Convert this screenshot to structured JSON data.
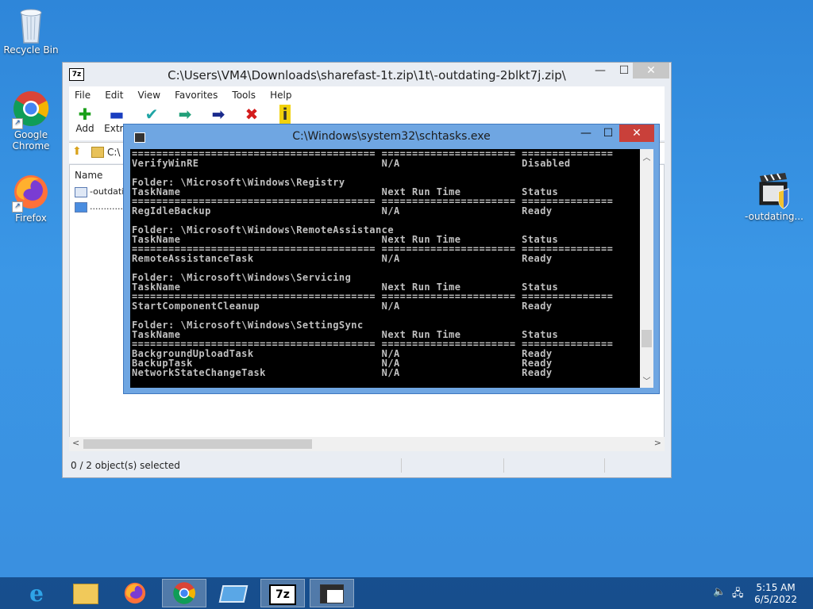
{
  "desktop": {
    "icons": [
      {
        "label": "Recycle Bin"
      },
      {
        "label": "Google Chrome"
      },
      {
        "label": "Firefox"
      },
      {
        "label": "-outdating..."
      }
    ]
  },
  "sevenzip": {
    "title": "C:\\Users\\VM4\\Downloads\\sharefast-1t.zip\\1t\\-outdating-2blkt7j.zip\\",
    "app_icon": "7z",
    "menu": [
      "File",
      "Edit",
      "View",
      "Favorites",
      "Tools",
      "Help"
    ],
    "toolbar": {
      "add_label": "Add",
      "extract_label": "Extra"
    },
    "address_value": "C:\\",
    "column_name": "Name",
    "files": [
      "-outdating",
      "............e"
    ],
    "status": "0 / 2 object(s) selected"
  },
  "console": {
    "title": "C:\\Windows\\system32\\schtasks.exe",
    "lines": [
      "======================================== ====================== ===============",
      "VerifyWinRE                              N/A                    Disabled",
      "",
      "Folder: \\Microsoft\\Windows\\Registry",
      "TaskName                                 Next Run Time          Status",
      "======================================== ====================== ===============",
      "RegIdleBackup                            N/A                    Ready",
      "",
      "Folder: \\Microsoft\\Windows\\RemoteAssistance",
      "TaskName                                 Next Run Time          Status",
      "======================================== ====================== ===============",
      "RemoteAssistanceTask                     N/A                    Ready",
      "",
      "Folder: \\Microsoft\\Windows\\Servicing",
      "TaskName                                 Next Run Time          Status",
      "======================================== ====================== ===============",
      "StartComponentCleanup                    N/A                    Ready",
      "",
      "Folder: \\Microsoft\\Windows\\SettingSync",
      "TaskName                                 Next Run Time          Status",
      "======================================== ====================== ===============",
      "BackgroundUploadTask                     N/A                    Ready",
      "BackupTask                               N/A                    Ready",
      "NetworkStateChangeTask                   N/A                    Ready"
    ]
  },
  "taskbar": {
    "apps": [
      "internet-explorer",
      "file-explorer",
      "firefox",
      "chrome",
      "remote-desktop",
      "7-zip",
      "console"
    ],
    "sevenzip_label": "7z",
    "time": "5:15 AM",
    "date": "6/5/2022"
  }
}
